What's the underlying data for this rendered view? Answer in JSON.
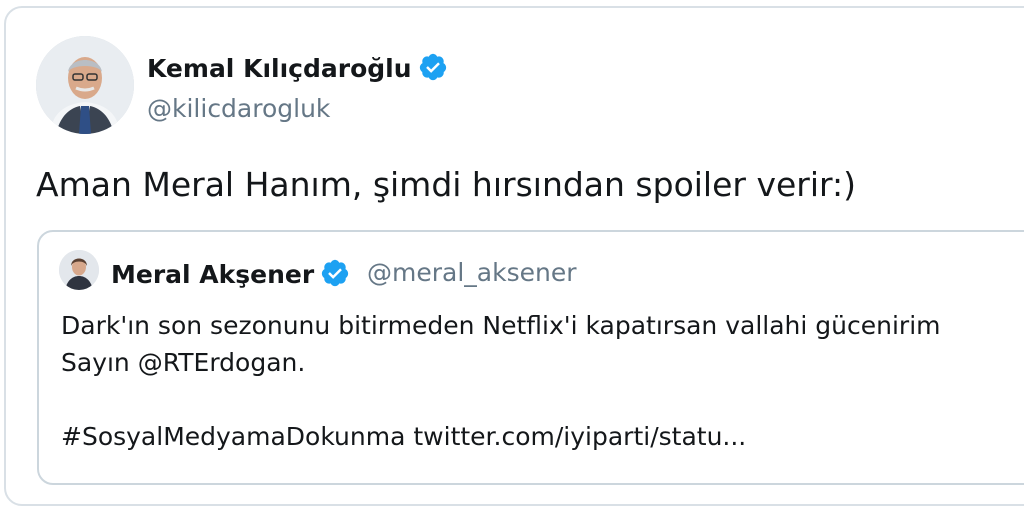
{
  "tweet": {
    "author": {
      "name": "Kemal Kılıçdaroğlu",
      "handle": "@kilicdarogluk",
      "avatar_icon": "profile-photo",
      "verified_icon": "verified-badge-icon"
    },
    "text": "Aman Meral Hanım, şimdi hırsından spoiler verir:)",
    "quoted": {
      "author": {
        "name": "Meral Akşener",
        "handle": "@meral_aksener",
        "avatar_icon": "profile-photo",
        "verified_icon": "verified-badge-icon"
      },
      "lines": [
        "Dark'ın son sezonunu bitirmeden Netflix'i kapatırsan vallahi gücenirim",
        "Sayın @RTErdogan.",
        "",
        "#SosyalMedyamaDokunma twitter.com/iyiparti/statu..."
      ]
    }
  },
  "colors": {
    "text": "#14171a",
    "secondary": "#657786",
    "verified": "#1da1f2",
    "border": "#ccd6dd"
  }
}
